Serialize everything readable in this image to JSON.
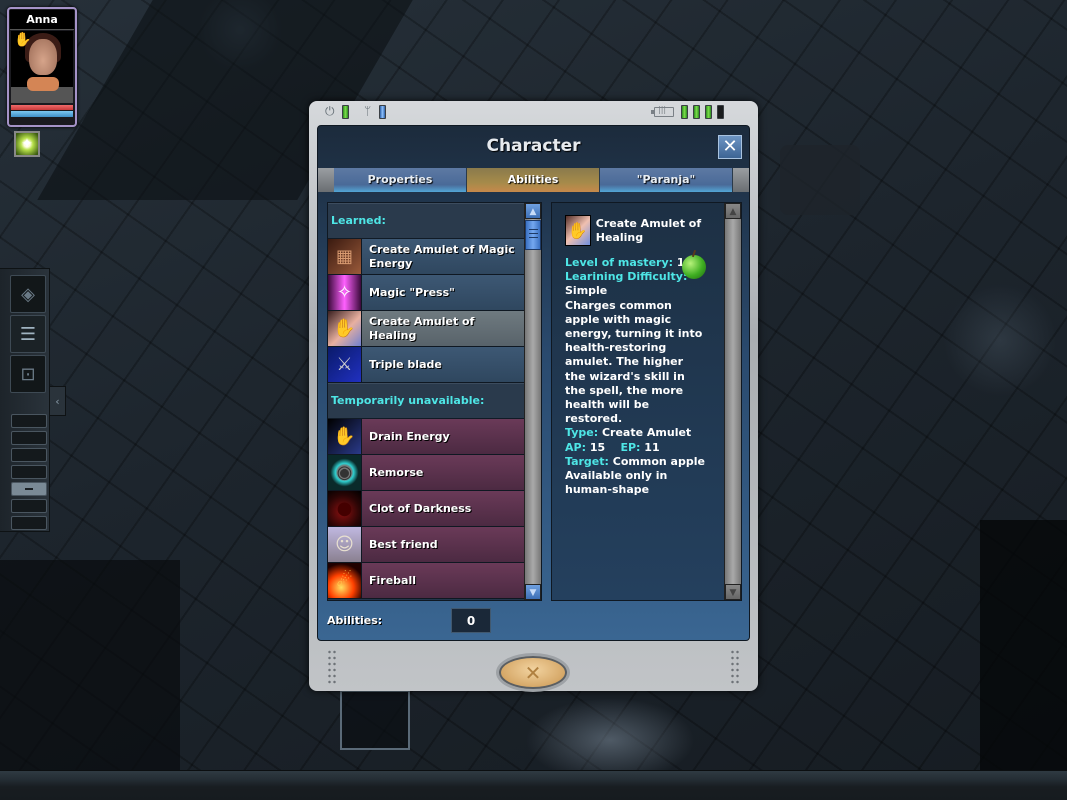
{
  "hud": {
    "character_name": "Anna",
    "health_fraction": 1.0,
    "mana_fraction": 1.0,
    "active_buff_icon": "light-burst-icon"
  },
  "side_panel": {
    "buttons": [
      {
        "name": "passport-icon",
        "glyph": "◈"
      },
      {
        "name": "quest-log-icon",
        "glyph": "☰"
      },
      {
        "name": "map-icon",
        "glyph": "⊡"
      }
    ],
    "expand_tab_glyph": "‹",
    "slots": [
      {
        "active": false
      },
      {
        "active": false
      },
      {
        "active": false
      },
      {
        "active": false
      },
      {
        "active": true
      },
      {
        "active": false
      },
      {
        "active": false
      }
    ]
  },
  "dialog": {
    "status": {
      "power_icon": "⏻",
      "antenna_icon": "ᛘ",
      "battery_segments_lit": 3,
      "battery_segments_total": 4
    },
    "title": "Character",
    "close_glyph": "✕",
    "tabs": [
      {
        "label": "Properties",
        "active": false
      },
      {
        "label": "Abilities",
        "active": true
      },
      {
        "label": "\"Paranja\"",
        "active": false
      }
    ],
    "list": {
      "learned_header": "Learned:",
      "learned": [
        {
          "label": "Create Amulet of Magic Energy",
          "icon": "chocolate-bar-icon",
          "glyph": "▦",
          "selected": false
        },
        {
          "label": "Magic \"Press\"",
          "icon": "magic-press-icon",
          "glyph": "✧",
          "selected": false
        },
        {
          "label": "Create Amulet of Healing",
          "icon": "healing-hand-icon",
          "glyph": "✋",
          "selected": true
        },
        {
          "label": "Triple blade",
          "icon": "triple-blade-icon",
          "glyph": "⚔",
          "selected": false
        }
      ],
      "unavailable_header": "Temporarily unavailable:",
      "unavailable": [
        {
          "label": "Drain Energy",
          "icon": "drain-hand-icon",
          "glyph": "✋"
        },
        {
          "label": "Remorse",
          "icon": "remorse-orb-icon",
          "glyph": "◉"
        },
        {
          "label": "Clot of Darkness",
          "icon": "dark-clot-icon",
          "glyph": "●"
        },
        {
          "label": "Best friend",
          "icon": "stone-face-icon",
          "glyph": "☺"
        },
        {
          "label": "Fireball",
          "icon": "fireball-icon",
          "glyph": "☄"
        }
      ]
    },
    "detail": {
      "title": "Create Amulet of Healing",
      "mastery_label": "Level of mastery:",
      "mastery_value": "1",
      "difficulty_label": "Learining Difficulty:",
      "difficulty_value": "Simple",
      "description": "Charges common apple with magic energy, turning it into health-restoring amulet. The higher the wizard's skill in the spell, the more health will be restored.",
      "type_label": "Type:",
      "type_value": "Create Amulet",
      "ap_label": "AP:",
      "ap_value": "15",
      "ep_label": "EP:",
      "ep_value": "11",
      "target_label": "Target:",
      "target_value": "Common apple",
      "note": "Available only in human-shape"
    },
    "footer": {
      "abilities_label": "Abilities:",
      "abilities_value": "0",
      "cancel_glyph": "✕"
    }
  },
  "colors": {
    "accent_cyan": "#4ee6e6",
    "tab_active": "#a58a4a",
    "tab_inactive": "#4a6a98",
    "row_unavailable": "#6a3a58",
    "row_learned": "#3d5874"
  }
}
